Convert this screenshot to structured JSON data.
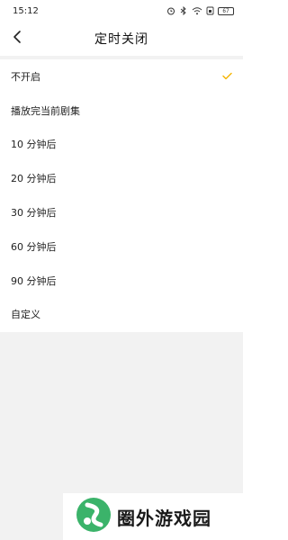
{
  "status_bar": {
    "time": "15:12",
    "icons": [
      "alarm-icon",
      "bluetooth-icon",
      "wifi-icon",
      "sim-icon",
      "battery-icon"
    ],
    "battery_level": "67"
  },
  "header": {
    "back_icon": "chevron-left-icon",
    "title": "定时关闭"
  },
  "options": [
    {
      "label": "不开启",
      "selected": true
    },
    {
      "label": "播放完当前剧集",
      "selected": false
    },
    {
      "label": "10 分钟后",
      "selected": false
    },
    {
      "label": "20 分钟后",
      "selected": false
    },
    {
      "label": "30 分钟后",
      "selected": false
    },
    {
      "label": "60 分钟后",
      "selected": false
    },
    {
      "label": "90 分钟后",
      "selected": false
    },
    {
      "label": "自定义",
      "selected": false
    }
  ],
  "colors": {
    "check": "#f5b400",
    "background_gray": "#f2f2f2",
    "logo_green": "#3bb36a"
  },
  "watermark": {
    "text": "圈外游戏园"
  }
}
